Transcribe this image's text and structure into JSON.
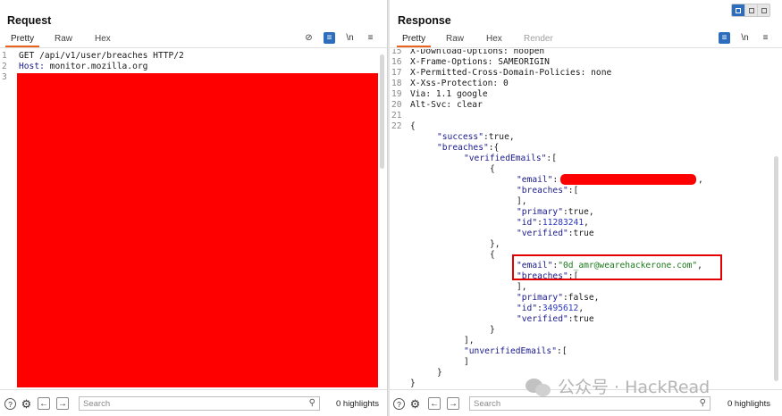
{
  "request": {
    "title": "Request",
    "tabs": [
      "Pretty",
      "Raw",
      "Hex"
    ],
    "lines": [
      {
        "n": "1",
        "text": "GET /api/v1/user/breaches HTTP/2"
      },
      {
        "n": "2",
        "name": "Host:",
        "value": " monitor.mozilla.org"
      },
      {
        "n": "3",
        "text": ""
      }
    ],
    "redaction_color": "#ff0000"
  },
  "response": {
    "title": "Response",
    "tabs": [
      "Pretty",
      "Raw",
      "Hex",
      "Render"
    ],
    "headers": [
      {
        "n": "15",
        "text": "X-Download-Options: noopen"
      },
      {
        "n": "16",
        "text": "X-Frame-Options: SAMEORIGIN"
      },
      {
        "n": "17",
        "text": "X-Permitted-Cross-Domain-Policies: none"
      },
      {
        "n": "18",
        "text": "X-Xss-Protection: 0"
      },
      {
        "n": "19",
        "text": "Via: 1.1 google"
      },
      {
        "n": "20",
        "text": "Alt-Svc: clear"
      },
      {
        "n": "21",
        "text": ""
      },
      {
        "n": "22",
        "text": "{"
      }
    ],
    "body": {
      "success_key": "\"success\"",
      "success_val": ":true,",
      "breaches_key": "\"breaches\"",
      "breaches_open": ":{",
      "verified_key": "\"verifiedEmails\"",
      "verified_open": ":[",
      "obj_open": "{",
      "email_key": "\"email\"",
      "colon": ":",
      "comma": ",",
      "breaches_inner_key": "\"breaches\"",
      "arr_open": ":[",
      "arr_close": "],",
      "primary_key": "\"primary\"",
      "primary1_val": ":true,",
      "id_key": "\"id\"",
      "id1_val": "11283241",
      "verified_inner_key": "\"verified\"",
      "verified1_val": ":true",
      "obj_close_comma": "},",
      "email2_val": "\"0d_amr@wearehackerone.com\"",
      "primary2_val": ":false,",
      "id2_val": "3495612",
      "verified2_val": ":true",
      "obj_close": "}",
      "list_close": "],",
      "unverified_key": "\"unverifiedEmails\"",
      "unverified_open": ":[",
      "unverified_close": "]",
      "inner_close": "}",
      "outer_close": "}"
    },
    "highlight_color": "#e00000"
  },
  "footer": {
    "search_placeholder": "Search",
    "highlights_left": "0 highlights",
    "highlights_right": "0 highlights",
    "help_icon": "?",
    "settings_icon": "⚙",
    "back_icon": "←",
    "forward_icon": "→",
    "search_icon": "⚲"
  },
  "icons": {
    "hide": "⊘",
    "wrap": "≡",
    "newline": "\\n",
    "menu": "≡"
  },
  "watermark": "公众号 · HackRead",
  "colors": {
    "accent": "#e8641e",
    "toolbar_blue": "#2c6ebd"
  }
}
